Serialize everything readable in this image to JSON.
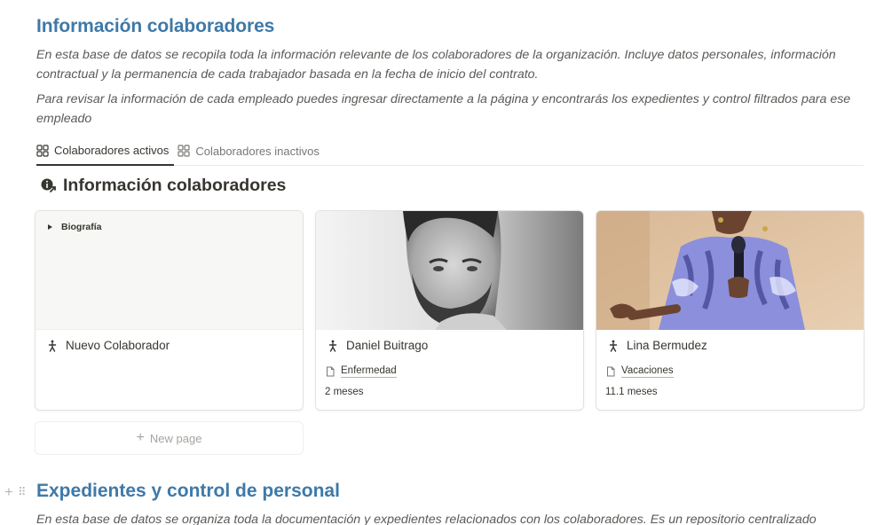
{
  "header": {
    "title": "Información colaboradores",
    "description_1": "En esta base de datos se recopila toda la información relevante de los colaboradores de la organización. Incluye datos personales, información contractual y la permanencia de cada trabajador basada en la fecha de inicio del contrato.",
    "description_2": "Para revisar la información de cada empleado puedes ingresar directamente a la página y encontrarás los expedientes y control filtrados para ese empleado"
  },
  "tabs": [
    {
      "label": "Colaboradores activos",
      "icon": "gallery-icon",
      "active": true
    },
    {
      "label": "Colaboradores inactivos",
      "icon": "gallery-icon",
      "active": false
    }
  ],
  "database": {
    "title": "Información colaboradores",
    "icon": "info-person-icon"
  },
  "cards": [
    {
      "name": "Nuevo Colaborador",
      "icon": "person-walking-icon",
      "cover_toggle": "Biografía",
      "tag": "",
      "meta": ""
    },
    {
      "name": "Daniel Buitrago",
      "icon": "person-walking-icon",
      "tag": "Enfermedad",
      "meta": "2 meses"
    },
    {
      "name": "Lina Bermudez",
      "icon": "person-walking-icon",
      "tag": "Vacaciones",
      "meta": "11.1 meses"
    }
  ],
  "new_page": {
    "label": "New page"
  },
  "section_2": {
    "title": "Expedientes y control de personal",
    "description": "En esta base de datos se organiza toda la documentación y expedientes relacionados con los colaboradores. Es un repositorio centralizado"
  },
  "colors": {
    "accent": "#3e79a8",
    "text": "#37352f",
    "muted": "#787774"
  }
}
